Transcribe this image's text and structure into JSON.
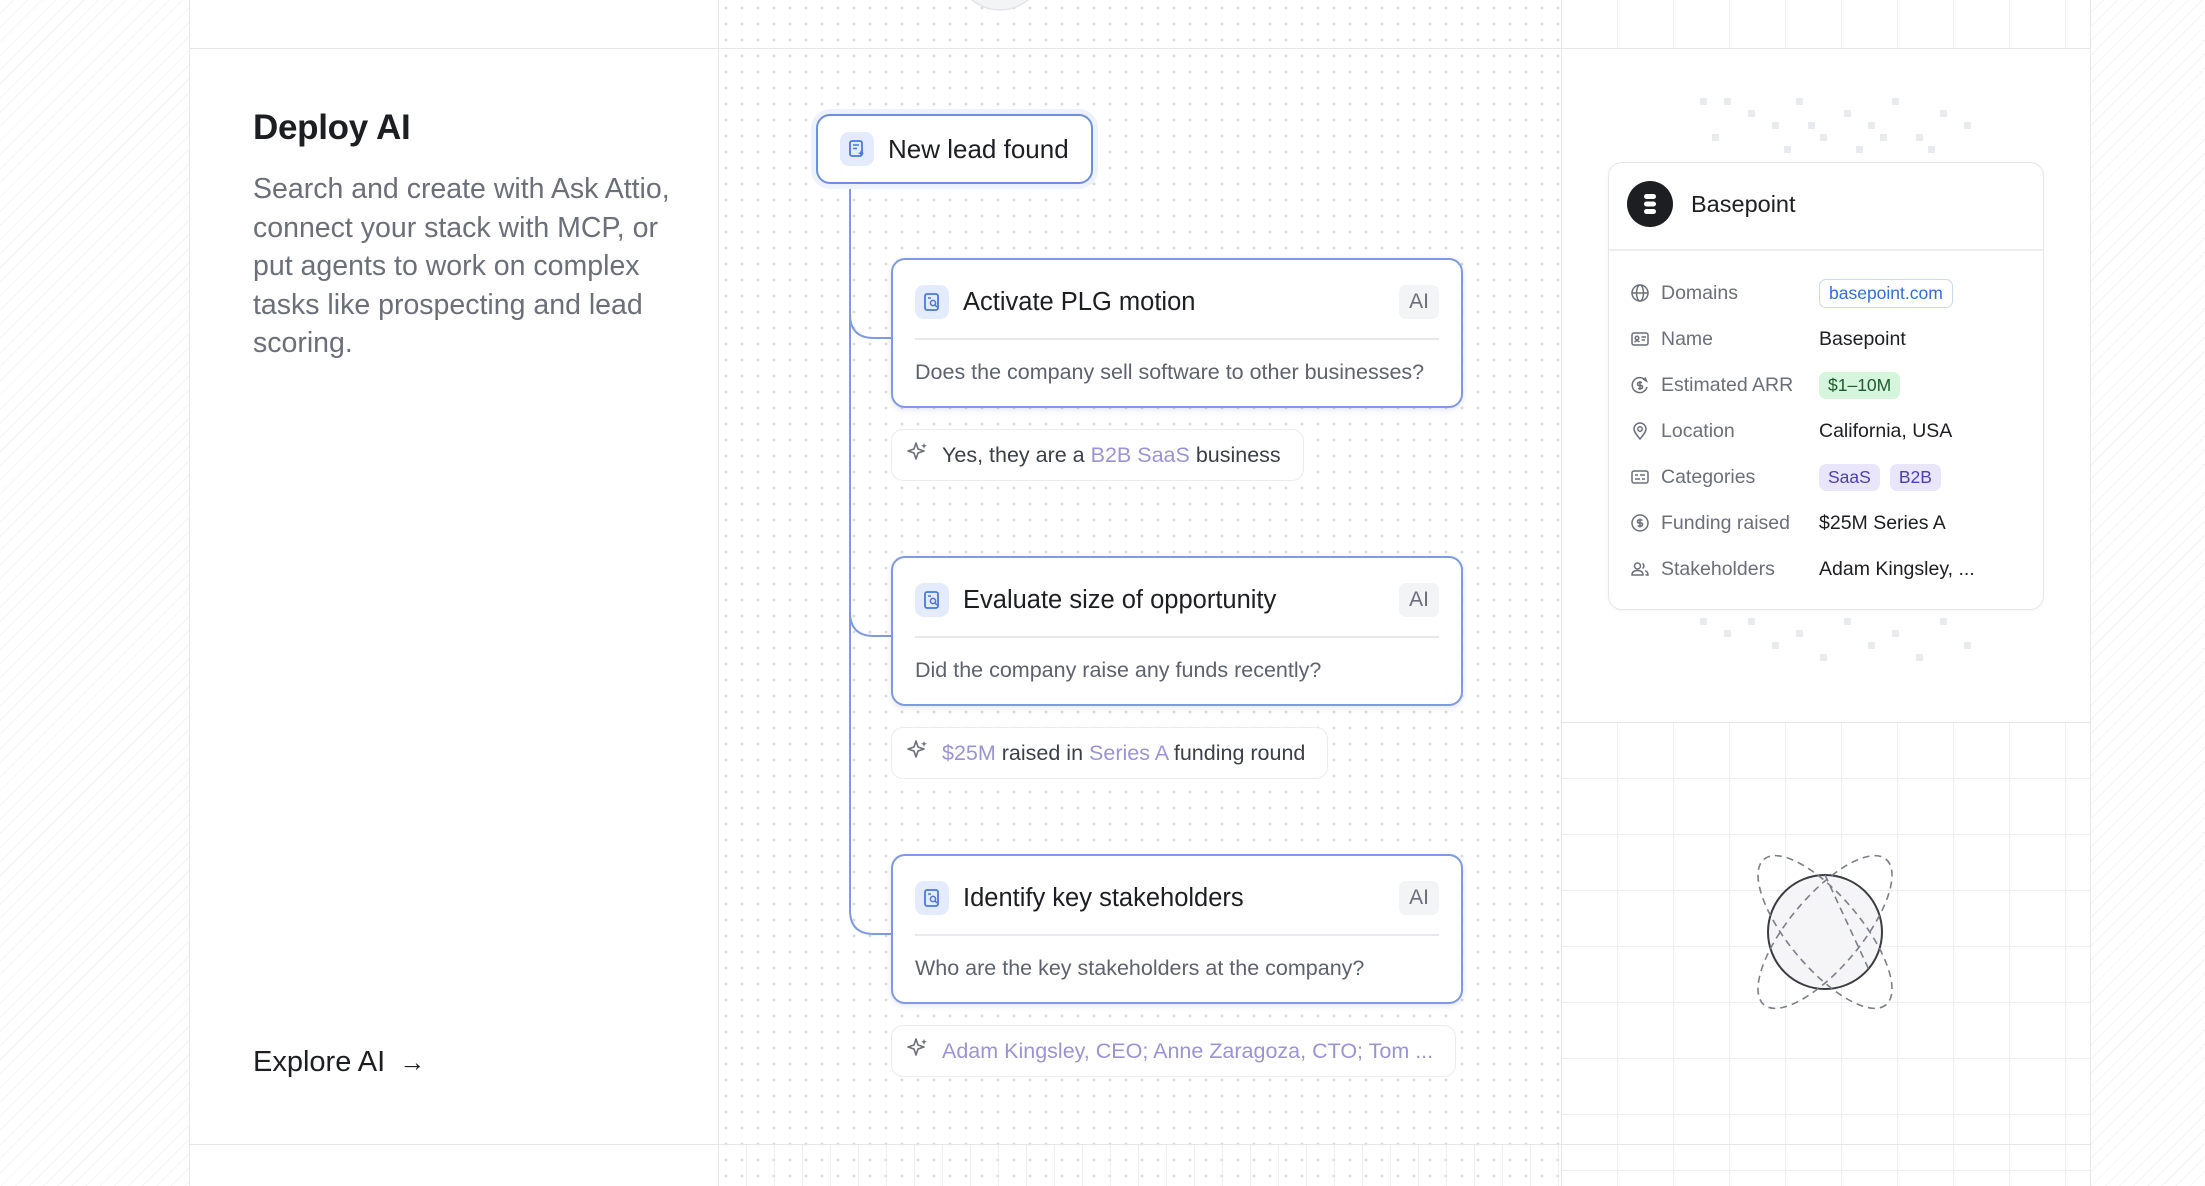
{
  "intro": {
    "title": "Deploy AI",
    "description": "Search and create with Ask Attio, connect your stack with MCP, or put agents to work on complex tasks like prospecting and lead scoring.",
    "explore_label": "Explore AI",
    "explore_arrow": "→"
  },
  "workflow": {
    "trigger_label": "New lead found",
    "steps": [
      {
        "title": "Activate PLG motion",
        "badge": "AI",
        "question": "Does the company sell software to other businesses?",
        "answer": {
          "pre": "Yes, they are a ",
          "hl1": "B2B SaaS",
          "mid": " business",
          "hl2": "",
          "post": ""
        }
      },
      {
        "title": "Evaluate size of opportunity",
        "badge": "AI",
        "question": "Did the company raise any funds recently?",
        "answer": {
          "pre": "",
          "hl1": "$25M",
          "mid": " raised in ",
          "hl2": "Series A",
          "post": " funding round"
        }
      },
      {
        "title": "Identify key stakeholders",
        "badge": "AI",
        "question": "Who are the key stakeholders at the company?",
        "answer": {
          "pre": "",
          "hl1": "Adam Kingsley, CEO; Anne Zaragoza, CTO; Tom ...",
          "mid": "",
          "hl2": "",
          "post": ""
        }
      }
    ]
  },
  "record": {
    "company": "Basepoint",
    "attributes": [
      {
        "label": "Domains",
        "icon": "globe-icon",
        "value": "basepoint.com",
        "style": "pill-blue"
      },
      {
        "label": "Name",
        "icon": "id-card-icon",
        "value": "Basepoint",
        "style": "text"
      },
      {
        "label": "Estimated ARR",
        "icon": "currency-icon",
        "value": "$1–10M",
        "style": "pill-green"
      },
      {
        "label": "Location",
        "icon": "location-pin-icon",
        "value": "California, USA",
        "style": "text"
      },
      {
        "label": "Categories",
        "icon": "tag-list-icon",
        "values": [
          "SaaS",
          "B2B"
        ],
        "style": "pill-purple"
      },
      {
        "label": "Funding raised",
        "icon": "dollar-circle-icon",
        "value": "$25M Series A",
        "style": "text"
      },
      {
        "label": "Stakeholders",
        "icon": "users-icon",
        "value": "Adam Kingsley, ...",
        "style": "text"
      }
    ]
  },
  "colors": {
    "accent_blue": "#6d8fe0",
    "highlight_purple": "#9a93d6",
    "text_primary": "#1d1e21",
    "text_muted": "#6b6f78"
  },
  "icons": [
    "workflow-trigger-icon",
    "ai-record-icon",
    "sparkle-icon",
    "orbit-illustration-icon",
    "arrow-right-icon"
  ]
}
